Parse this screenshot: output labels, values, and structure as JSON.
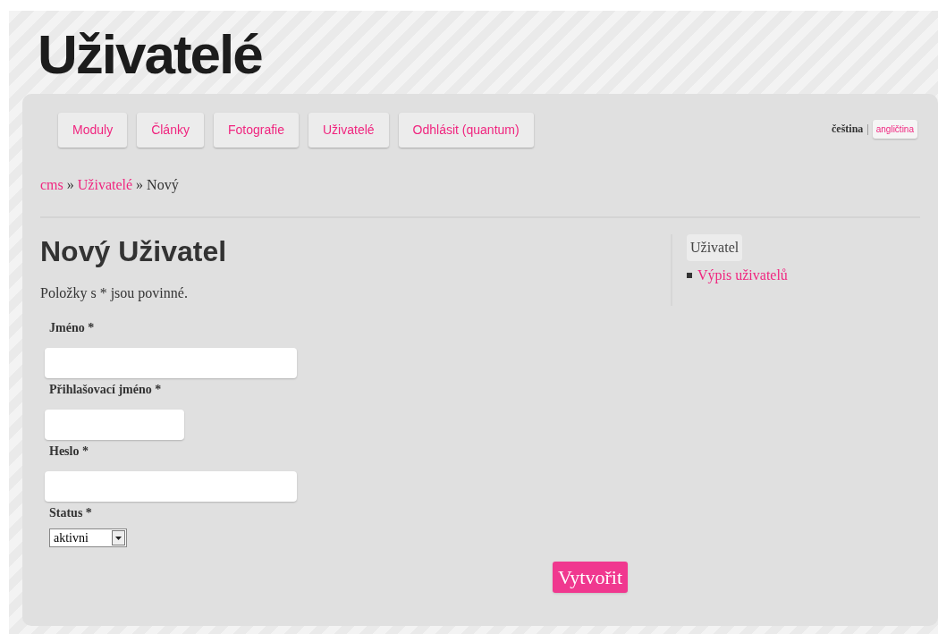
{
  "site_title": "Uživatelé",
  "nav": [
    {
      "label": "Moduly"
    },
    {
      "label": "Články"
    },
    {
      "label": "Fotografie"
    },
    {
      "label": "Uživatelé"
    },
    {
      "label": "Odhlásit (quantum)"
    }
  ],
  "languages": {
    "separator": "|",
    "items": [
      {
        "label": "čeština",
        "selected": true
      },
      {
        "label": "angličtina",
        "selected": false
      }
    ]
  },
  "breadcrumb": {
    "separator": "»",
    "items": [
      {
        "label": "cms",
        "kind": "link"
      },
      {
        "label": "Uživatelé",
        "kind": "link"
      },
      {
        "label": "Nový",
        "kind": "current"
      }
    ]
  },
  "heading": "Nový Uživatel",
  "note": "Položky s * jsou povinné.",
  "form": {
    "fields": [
      {
        "label": "Jméno *",
        "kind": "wide"
      },
      {
        "label": "Přihlašovací jméno *",
        "kind": "narrow"
      },
      {
        "label": "Heslo *",
        "kind": "wide"
      },
      {
        "label": "Status *",
        "kind": "select",
        "value": "aktivni"
      }
    ],
    "submit": "Vytvořit"
  },
  "sidebar": {
    "title": "Uživatel",
    "links": [
      "Výpis uživatelů"
    ]
  }
}
